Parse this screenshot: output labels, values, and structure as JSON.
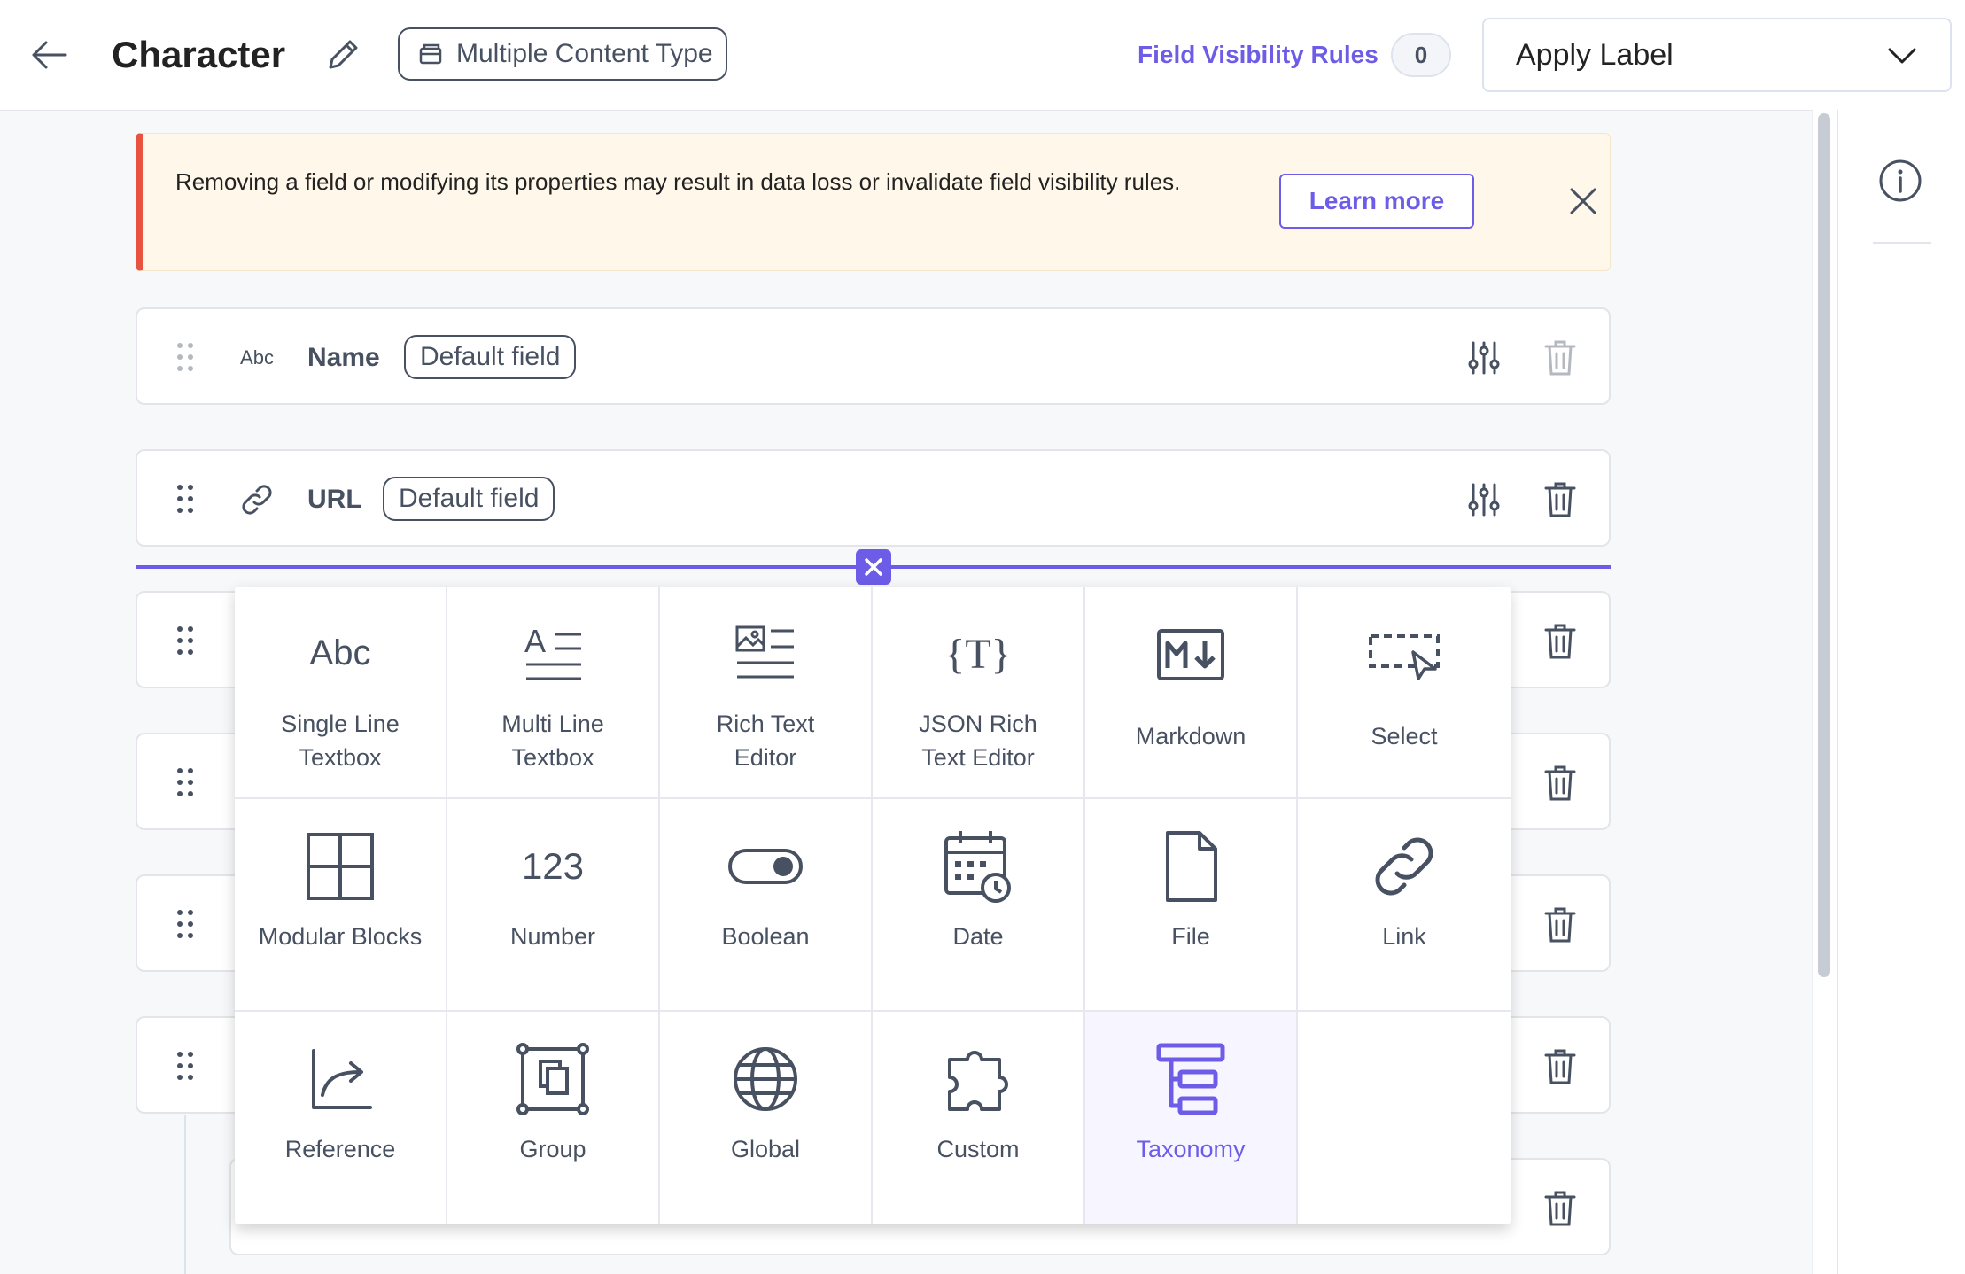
{
  "header": {
    "title": "Character",
    "content_type_label": "Multiple Content Type",
    "field_visibility_rules_label": "Field Visibility Rules",
    "field_visibility_rules_count": "0",
    "apply_label_placeholder": "Apply Label"
  },
  "banner": {
    "message": "Removing a field or modifying its properties may result in data loss or invalidate field visibility rules.",
    "learn_more_label": "Learn more"
  },
  "fields": [
    {
      "type_icon": "Abc",
      "name": "Name",
      "badge": "Default field"
    },
    {
      "type_icon": "link-icon",
      "name": "URL",
      "badge": "Default field"
    }
  ],
  "field_picker": {
    "items": [
      {
        "label": "Single Line Textbox",
        "icon": "abc-icon"
      },
      {
        "label": "Multi Line Textbox",
        "icon": "multiline-text-icon"
      },
      {
        "label": "Rich Text Editor",
        "icon": "rich-text-icon"
      },
      {
        "label": "JSON Rich Text Editor",
        "icon": "json-rte-icon"
      },
      {
        "label": "Markdown",
        "icon": "markdown-icon"
      },
      {
        "label": "Select",
        "icon": "select-icon"
      },
      {
        "label": "Modular Blocks",
        "icon": "modular-blocks-icon"
      },
      {
        "label": "Number",
        "icon": "number-icon"
      },
      {
        "label": "Boolean",
        "icon": "toggle-icon"
      },
      {
        "label": "Date",
        "icon": "calendar-icon"
      },
      {
        "label": "File",
        "icon": "file-icon"
      },
      {
        "label": "Link",
        "icon": "link-icon"
      },
      {
        "label": "Reference",
        "icon": "reference-icon"
      },
      {
        "label": "Group",
        "icon": "group-icon"
      },
      {
        "label": "Global",
        "icon": "globe-icon"
      },
      {
        "label": "Custom",
        "icon": "puzzle-icon"
      },
      {
        "label": "Taxonomy",
        "icon": "taxonomy-icon",
        "selected": true
      }
    ]
  },
  "colors": {
    "accent": "#6c5ce7",
    "warning_border": "#e8533f",
    "warning_bg": "#fff8ea",
    "text_muted": "#475161"
  }
}
